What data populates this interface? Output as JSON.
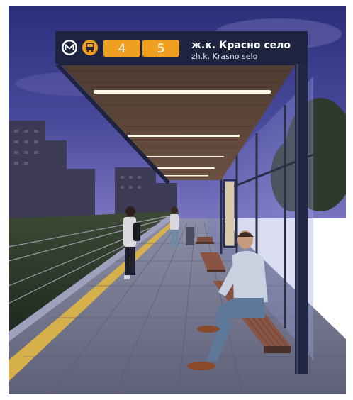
{
  "sign": {
    "route_1": "4",
    "route_2": "5",
    "stop_name_bg": "ж.к. Красно село",
    "stop_name_latin": "zh.k. Krasno selo",
    "metro_icon": "metro-m-icon",
    "bus_icon": "bus-icon"
  },
  "colors": {
    "sky_top": "#2b2f7a",
    "sky_bottom": "#6d68b8",
    "sign_background": "#1e2440",
    "route_badge": "#f0a020",
    "canopy_wood": "#5a4437",
    "structure": "#2a2f45",
    "bench_wood": "#7a4a3a",
    "tactile_strip": "#d6b04a",
    "platform_tiles": "#6f7188"
  }
}
